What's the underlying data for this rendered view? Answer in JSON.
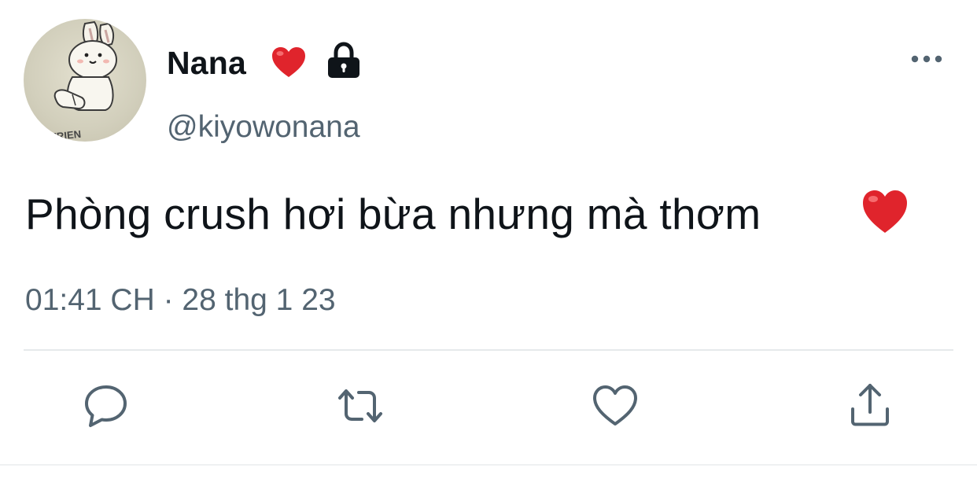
{
  "author": {
    "display_name": "Nana",
    "handle": "@kiyowonana",
    "avatar_icon": "bunny-avatar",
    "badges": [
      "heart-icon",
      "lock-icon"
    ]
  },
  "tweet": {
    "text": "Phòng crush hơi bừa nhưng mà thơm",
    "trailing_emoji": "heart-icon",
    "timestamp": "01:41 CH · 28 thg 1 23"
  },
  "actions": [
    {
      "name": "reply",
      "icon": "reply-icon"
    },
    {
      "name": "retweet",
      "icon": "retweet-icon"
    },
    {
      "name": "like",
      "icon": "like-heart-icon"
    },
    {
      "name": "share",
      "icon": "share-icon"
    }
  ],
  "colors": {
    "text_primary": "#0f1419",
    "text_secondary": "#536471",
    "heart_red": "#e0242c",
    "divider": "#e6e9eb"
  }
}
